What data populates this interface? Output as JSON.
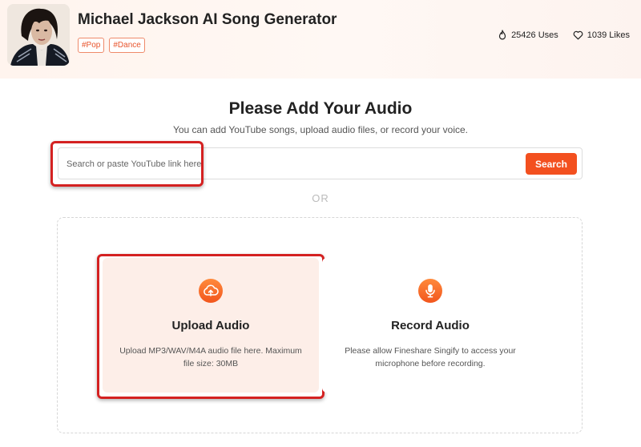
{
  "header": {
    "title": "Michael Jackson AI Song Generator",
    "tags": [
      "#Pop",
      "#Dance"
    ],
    "uses_label": "25426 Uses",
    "likes_label": "1039 Likes",
    "avatar_icon": "artist-portrait",
    "uses_icon": "flame-icon",
    "likes_icon": "heart-icon"
  },
  "main": {
    "title": "Please Add Your Audio",
    "subtitle": "You can add YouTube songs, upload audio files, or record your voice."
  },
  "search": {
    "placeholder": "Search or paste YouTube link here",
    "value": "",
    "button_label": "Search"
  },
  "divider": {
    "label": "OR"
  },
  "cards": {
    "upload": {
      "icon": "cloud-upload-icon",
      "title": "Upload Audio",
      "description": "Upload MP3/WAV/M4A audio file here. Maximum file size: 30MB"
    },
    "record": {
      "icon": "microphone-icon",
      "title": "Record Audio",
      "description": "Please allow Fineshare Singify to access your microphone before recording."
    }
  },
  "colors": {
    "accent": "#f3501f",
    "highlight_outline": "#d42121",
    "upload_card_bg": "#fdeee8"
  }
}
